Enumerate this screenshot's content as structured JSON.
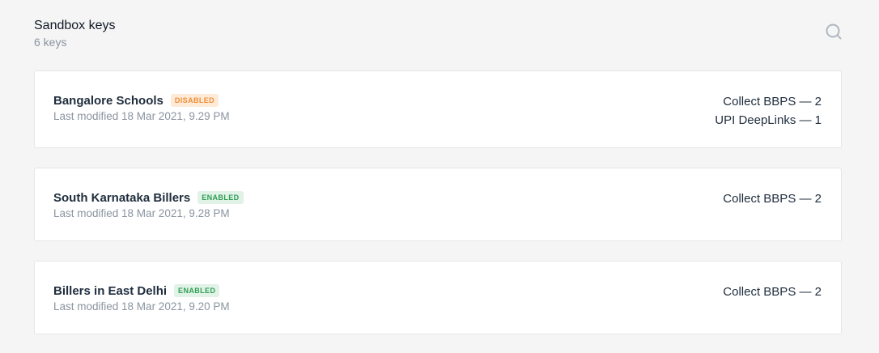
{
  "header": {
    "title": "Sandbox keys",
    "count": "6 keys",
    "search_icon": "search-icon"
  },
  "colors": {
    "background": "#f5f5f5",
    "card": "#ffffff",
    "disabled_badge_bg": "#fdebd8",
    "disabled_badge_text": "#f08c33",
    "enabled_badge_bg": "#e1f2e6",
    "enabled_badge_text": "#2f9e55"
  },
  "keys": [
    {
      "name": "Bangalore Schools",
      "status": "DISABLED",
      "modified": "Last modified 18 Mar 2021, 9.29 PM",
      "products": [
        "Collect BBPS — 2",
        "UPI DeepLinks — 1"
      ]
    },
    {
      "name": "South Karnataka Billers",
      "status": "ENABLED",
      "modified": "Last modified 18 Mar 2021, 9.28 PM",
      "products": [
        "Collect BBPS — 2"
      ]
    },
    {
      "name": "Billers in East Delhi",
      "status": "ENABLED",
      "modified": "Last modified 18 Mar 2021, 9.20 PM",
      "products": [
        "Collect BBPS — 2"
      ]
    }
  ]
}
